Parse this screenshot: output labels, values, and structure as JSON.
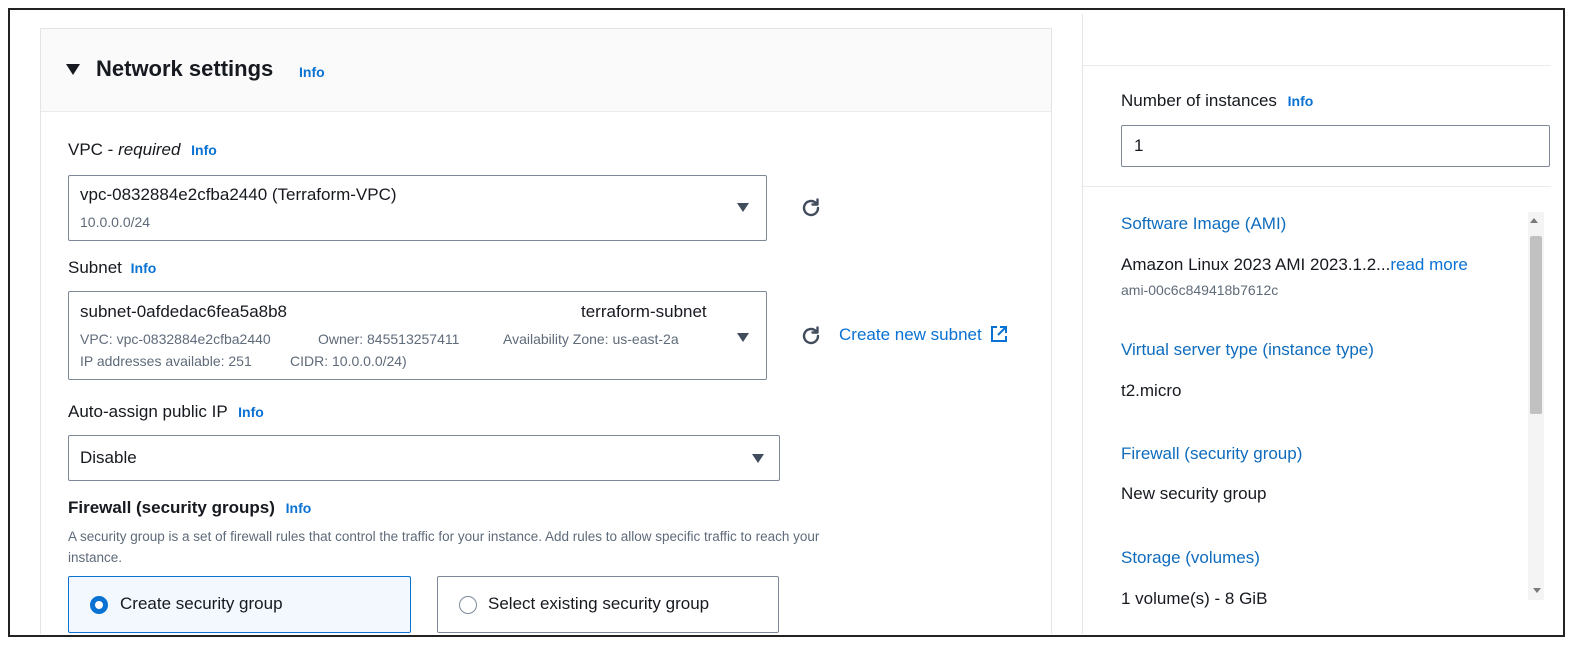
{
  "network": {
    "title": "Network settings",
    "info": "Info",
    "vpc": {
      "label": "VPC - ",
      "label_italic": "required",
      "info": "Info",
      "value": "vpc-0832884e2cfba2440 (Terraform-VPC)",
      "cidr": "10.0.0.0/24"
    },
    "subnet": {
      "label": "Subnet",
      "info": "Info",
      "id": "subnet-0afdedac6fea5a8b8",
      "name": "terraform-subnet",
      "vpc": "VPC: vpc-0832884e2cfba2440",
      "owner": "Owner: 845513257411",
      "az": "Availability Zone: us-east-2a",
      "ips": "IP addresses available: 251",
      "cidr": "CIDR: 10.0.0.0/24)",
      "create_link": "Create new subnet"
    },
    "public_ip": {
      "label": "Auto-assign public IP",
      "info": "Info",
      "value": "Disable"
    },
    "firewall": {
      "label": "Firewall (security groups)",
      "info": "Info",
      "description_line1": "A security group is a set of firewall rules that control the traffic for your instance. Add rules to allow specific traffic to reach your",
      "description_line2": "instance.",
      "option_create": "Create security group",
      "option_select": "Select existing security group",
      "selected": "Create security group"
    }
  },
  "summary": {
    "instances_label": "Number of instances",
    "instances_info": "Info",
    "instances_value": "1",
    "ami_heading": "Software Image (AMI)",
    "ami_value": "Amazon Linux 2023 AMI 2023.1.2...",
    "ami_read_more": "read more",
    "ami_id": "ami-00c6c849418b7612c",
    "type_heading": "Virtual server type (instance type)",
    "type_value": "t2.micro",
    "firewall_heading": "Firewall (security group)",
    "firewall_value": "New security group",
    "storage_heading": "Storage (volumes)",
    "storage_value": "1 volume(s) - 8 GiB"
  },
  "icons": {
    "caret": "caret-down-icon",
    "dropdown": "dropdown-triangle-icon",
    "refresh": "refresh-icon",
    "external": "external-link-icon"
  },
  "colors": {
    "link": "#0972d3",
    "selected_bg": "#f2f8fd",
    "summary_heading": "#0f6cbd"
  }
}
